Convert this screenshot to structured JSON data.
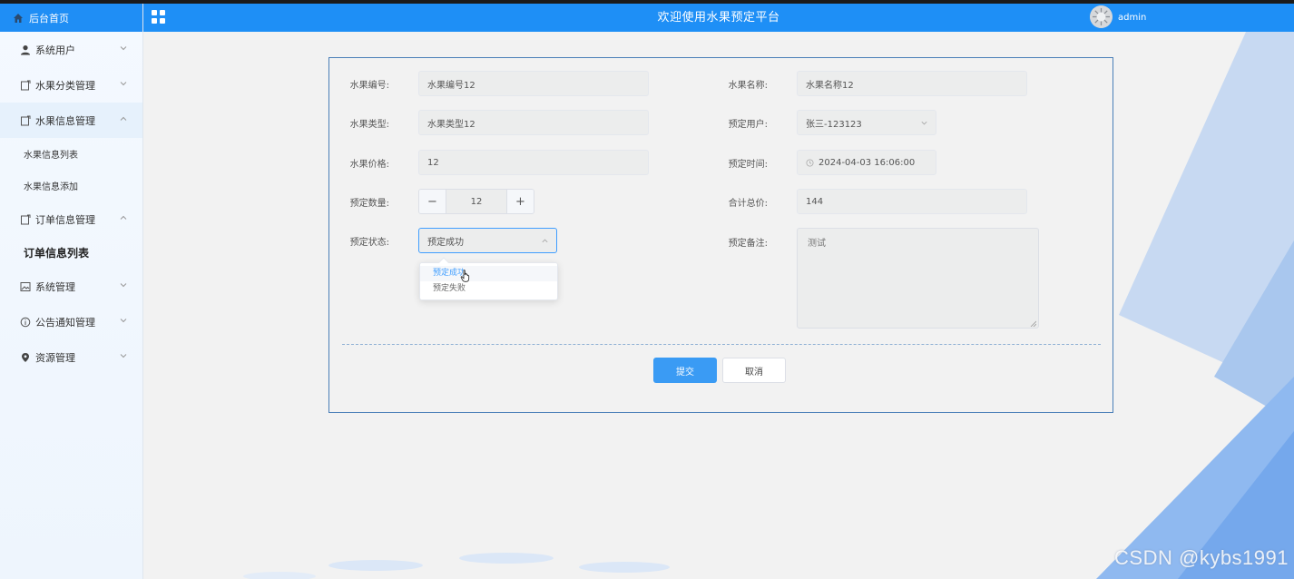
{
  "sidebar": {
    "home_label": "后台首页",
    "items": [
      {
        "label": "系统用户",
        "icon": "user-icon",
        "expanded": false
      },
      {
        "label": "水果分类管理",
        "icon": "document-icon",
        "expanded": false
      },
      {
        "label": "水果信息管理",
        "icon": "document-icon",
        "expanded": true,
        "children": [
          "水果信息列表",
          "水果信息添加"
        ]
      },
      {
        "label": "订单信息管理",
        "icon": "document-icon",
        "expanded": true,
        "children": [
          "订单信息列表"
        ]
      },
      {
        "label": "系统管理",
        "icon": "image-icon",
        "expanded": false
      },
      {
        "label": "公告通知管理",
        "icon": "info-icon",
        "expanded": false
      },
      {
        "label": "资源管理",
        "icon": "location-icon",
        "expanded": false
      }
    ],
    "active_child": "订单信息列表"
  },
  "header": {
    "title": "欢迎使用水果预定平台",
    "username": "admin"
  },
  "form": {
    "fruit_code_label": "水果编号:",
    "fruit_code_value": "水果编号12",
    "fruit_name_label": "水果名称:",
    "fruit_name_value": "水果名称12",
    "fruit_type_label": "水果类型:",
    "fruit_type_value": "水果类型12",
    "booking_user_label": "预定用户:",
    "booking_user_value": "张三-123123",
    "fruit_price_label": "水果价格:",
    "fruit_price_value": "12",
    "booking_time_label": "预定时间:",
    "booking_time_value": "2024-04-03 16:06:00",
    "quantity_label": "预定数量:",
    "quantity_value": "12",
    "quantity_minus": "−",
    "quantity_plus": "+",
    "total_label": "合计总价:",
    "total_value": "144",
    "status_label": "预定状态:",
    "status_value": "预定成功",
    "status_options": [
      "预定成功",
      "预定失败"
    ],
    "remark_label": "预定备注:",
    "remark_value": "测试",
    "submit_label": "提交",
    "cancel_label": "取消"
  },
  "watermark": "CSDN @kybs1991",
  "colors": {
    "primary": "#1e8ff6",
    "panel_border": "#4a7fb8",
    "option_selected": "#409eff"
  }
}
